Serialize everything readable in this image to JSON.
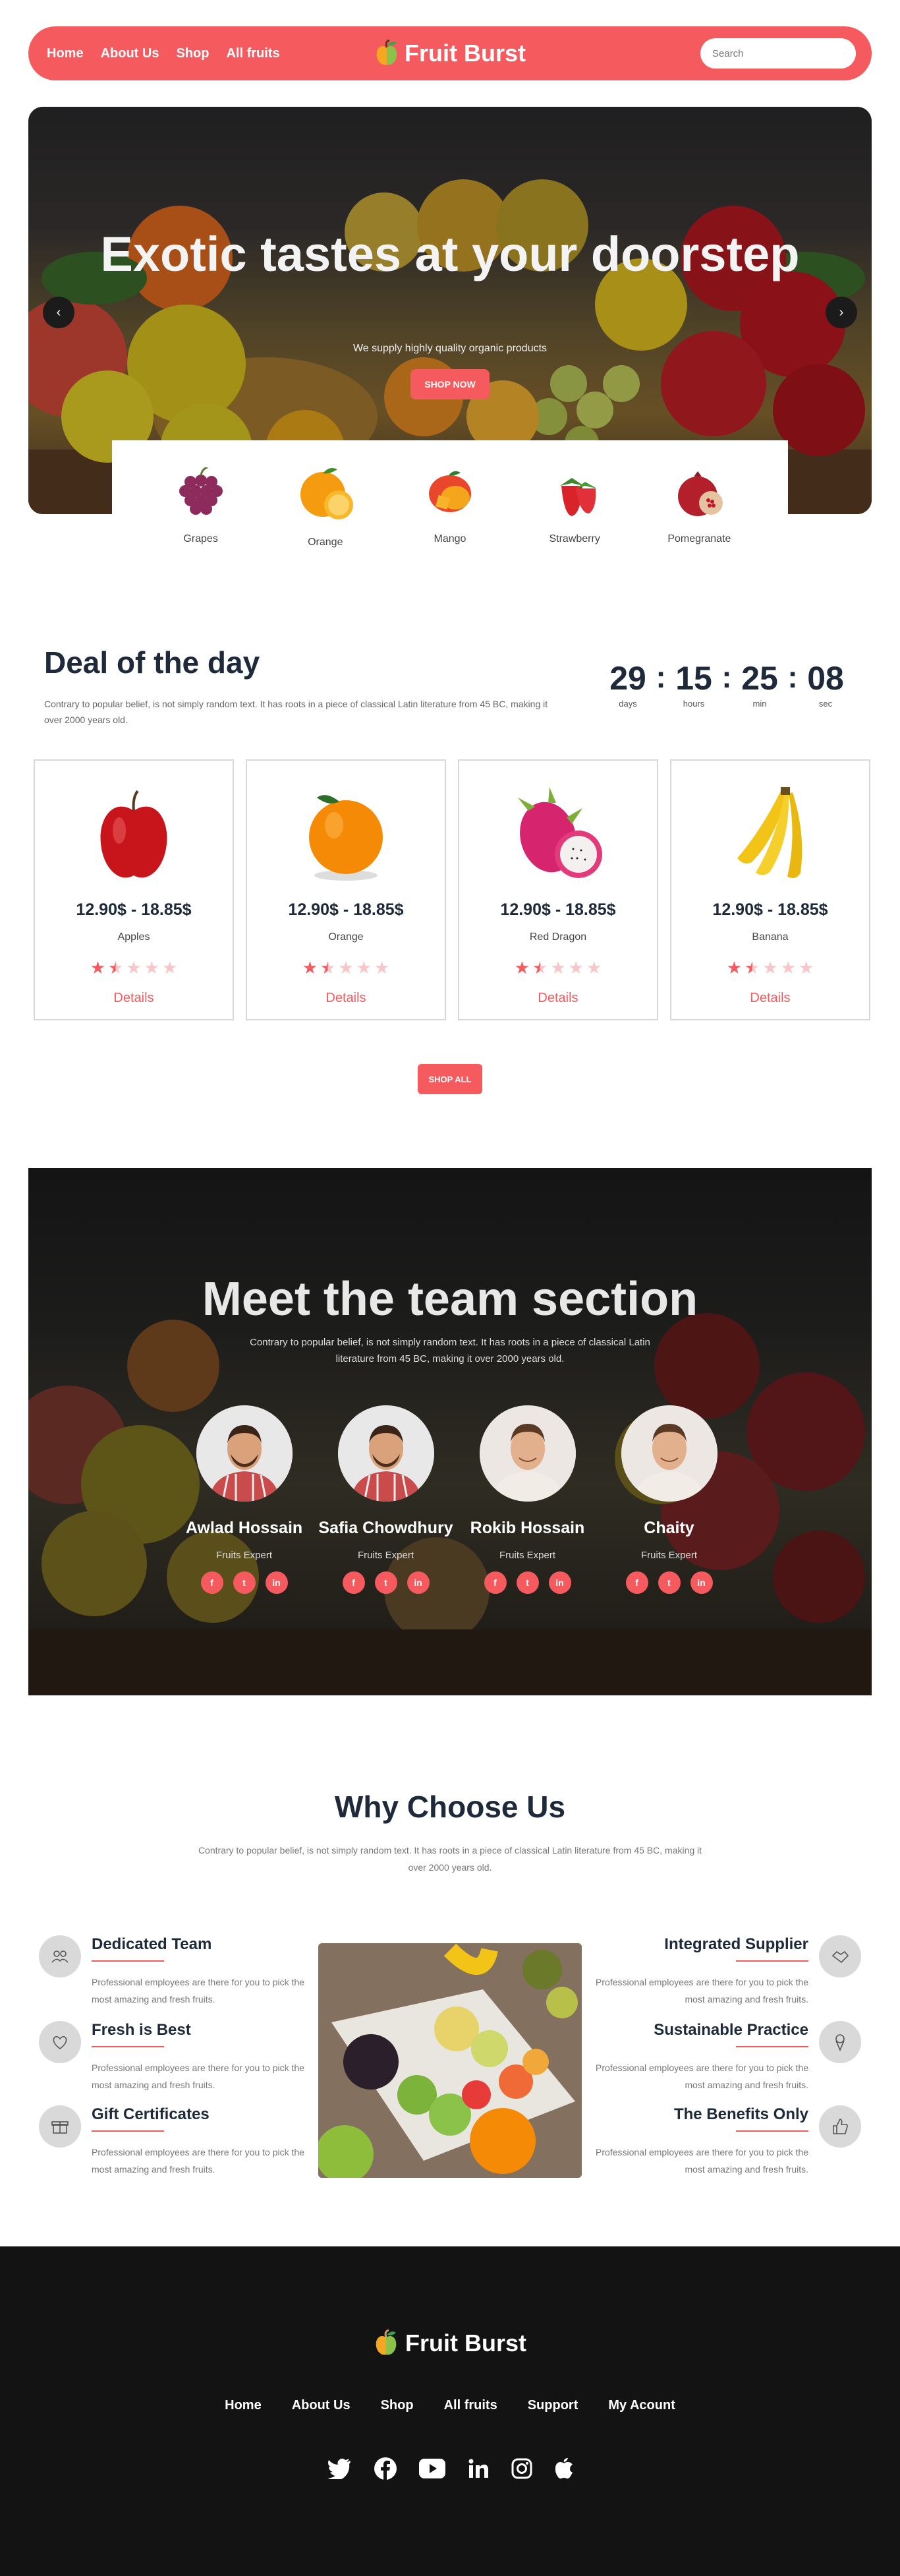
{
  "nav": {
    "links": [
      "Home",
      "About Us",
      "Shop",
      "All fruits"
    ],
    "brand": "Fruit Burst",
    "search_placeholder": "Search"
  },
  "hero": {
    "title": "Exotic tastes at your doorstep",
    "subtitle": "We supply highly quality organic products",
    "button": "SHOP NOW",
    "prev_icon": "chevron-left-icon",
    "next_icon": "chevron-right-icon",
    "categories": [
      {
        "label": "Grapes",
        "icon": "grapes-icon"
      },
      {
        "label": "Orange",
        "icon": "orange-icon"
      },
      {
        "label": "Mango",
        "icon": "mango-icon"
      },
      {
        "label": "Strawberry",
        "icon": "strawberry-icon"
      },
      {
        "label": "Pomegranate",
        "icon": "pomegranate-icon"
      }
    ]
  },
  "deal": {
    "title": "Deal of the day",
    "description": "Contrary to popular belief, is not simply random text. It has roots in a piece of classical Latin literature from 45 BC, making it over 2000 years old.",
    "countdown": {
      "days": "29",
      "days_label": "days",
      "hours": "15",
      "hours_label": "hours",
      "min": "25",
      "min_label": "min",
      "sec": "08",
      "sec_label": "sec",
      "separator": ":"
    },
    "products": [
      {
        "price": "12.90$ - 18.85$",
        "name": "Apples",
        "rating": 1.5,
        "details": "Details",
        "color": "#c8151c"
      },
      {
        "price": "12.90$ - 18.85$",
        "name": "Orange",
        "rating": 1.5,
        "details": "Details",
        "color": "#f58a07"
      },
      {
        "price": "12.90$ - 18.85$",
        "name": "Red Dragon",
        "rating": 1.5,
        "details": "Details",
        "color": "#d6246e"
      },
      {
        "price": "12.90$ - 18.85$",
        "name": "Banana",
        "rating": 1.5,
        "details": "Details",
        "color": "#f2c418"
      }
    ],
    "shop_all": "SHOP ALL"
  },
  "team": {
    "title": "Meet the team section",
    "subtitle": "Contrary to popular belief, is not simply random text. It has roots in a piece of classical Latin literature from 45 BC, making it over 2000 years old.",
    "members": [
      {
        "name": "Awlad Hossain",
        "role": "Fruits Expert"
      },
      {
        "name": "Safia Chowdhury",
        "role": "Fruits Expert"
      },
      {
        "name": "Rokib Hossain",
        "role": "Fruits Expert"
      },
      {
        "name": "Chaity",
        "role": "Fruits Expert"
      }
    ],
    "social_icons": [
      "facebook-icon",
      "twitter-icon",
      "linkedin-icon"
    ]
  },
  "why": {
    "title": "Why Choose Us",
    "subtitle": "Contrary to popular belief, is not simply random text. It has roots in a piece of classical Latin literature from 45 BC, making it over 2000 years old.",
    "left": [
      {
        "title": "Dedicated Team",
        "text": "Professional employees are there for you to pick the most amazing and fresh fruits.",
        "icon": "team-icon"
      },
      {
        "title": "Fresh is Best",
        "text": "Professional employees are there for you to pick the most amazing and fresh fruits.",
        "icon": "heart-icon"
      },
      {
        "title": "Gift Certificates",
        "text": "Professional employees are there for you to pick the most amazing and fresh fruits.",
        "icon": "gift-icon"
      }
    ],
    "right": [
      {
        "title": "Integrated Supplier",
        "text": "Professional employees are there for you to pick the most amazing and fresh fruits.",
        "icon": "handshake-icon"
      },
      {
        "title": "Sustainable Practice",
        "text": "Professional employees are there for you to pick the most amazing and fresh fruits.",
        "icon": "ice-cream-icon"
      },
      {
        "title": "The Benefits Only",
        "text": "Professional employees are there for you to pick the most amazing and fresh fruits.",
        "icon": "thumbs-up-icon"
      }
    ]
  },
  "footer": {
    "brand": "Fruit Burst",
    "links": [
      "Home",
      "About Us",
      "Shop",
      "All fruits",
      "Support",
      "My Acount"
    ],
    "social_icons": [
      "twitter-icon",
      "facebook-icon",
      "youtube-icon",
      "linkedin-icon",
      "instagram-icon",
      "apple-icon"
    ]
  },
  "colors": {
    "accent": "#f55a5e",
    "dark": "#1e2a3a",
    "footer_bg": "#131314"
  }
}
